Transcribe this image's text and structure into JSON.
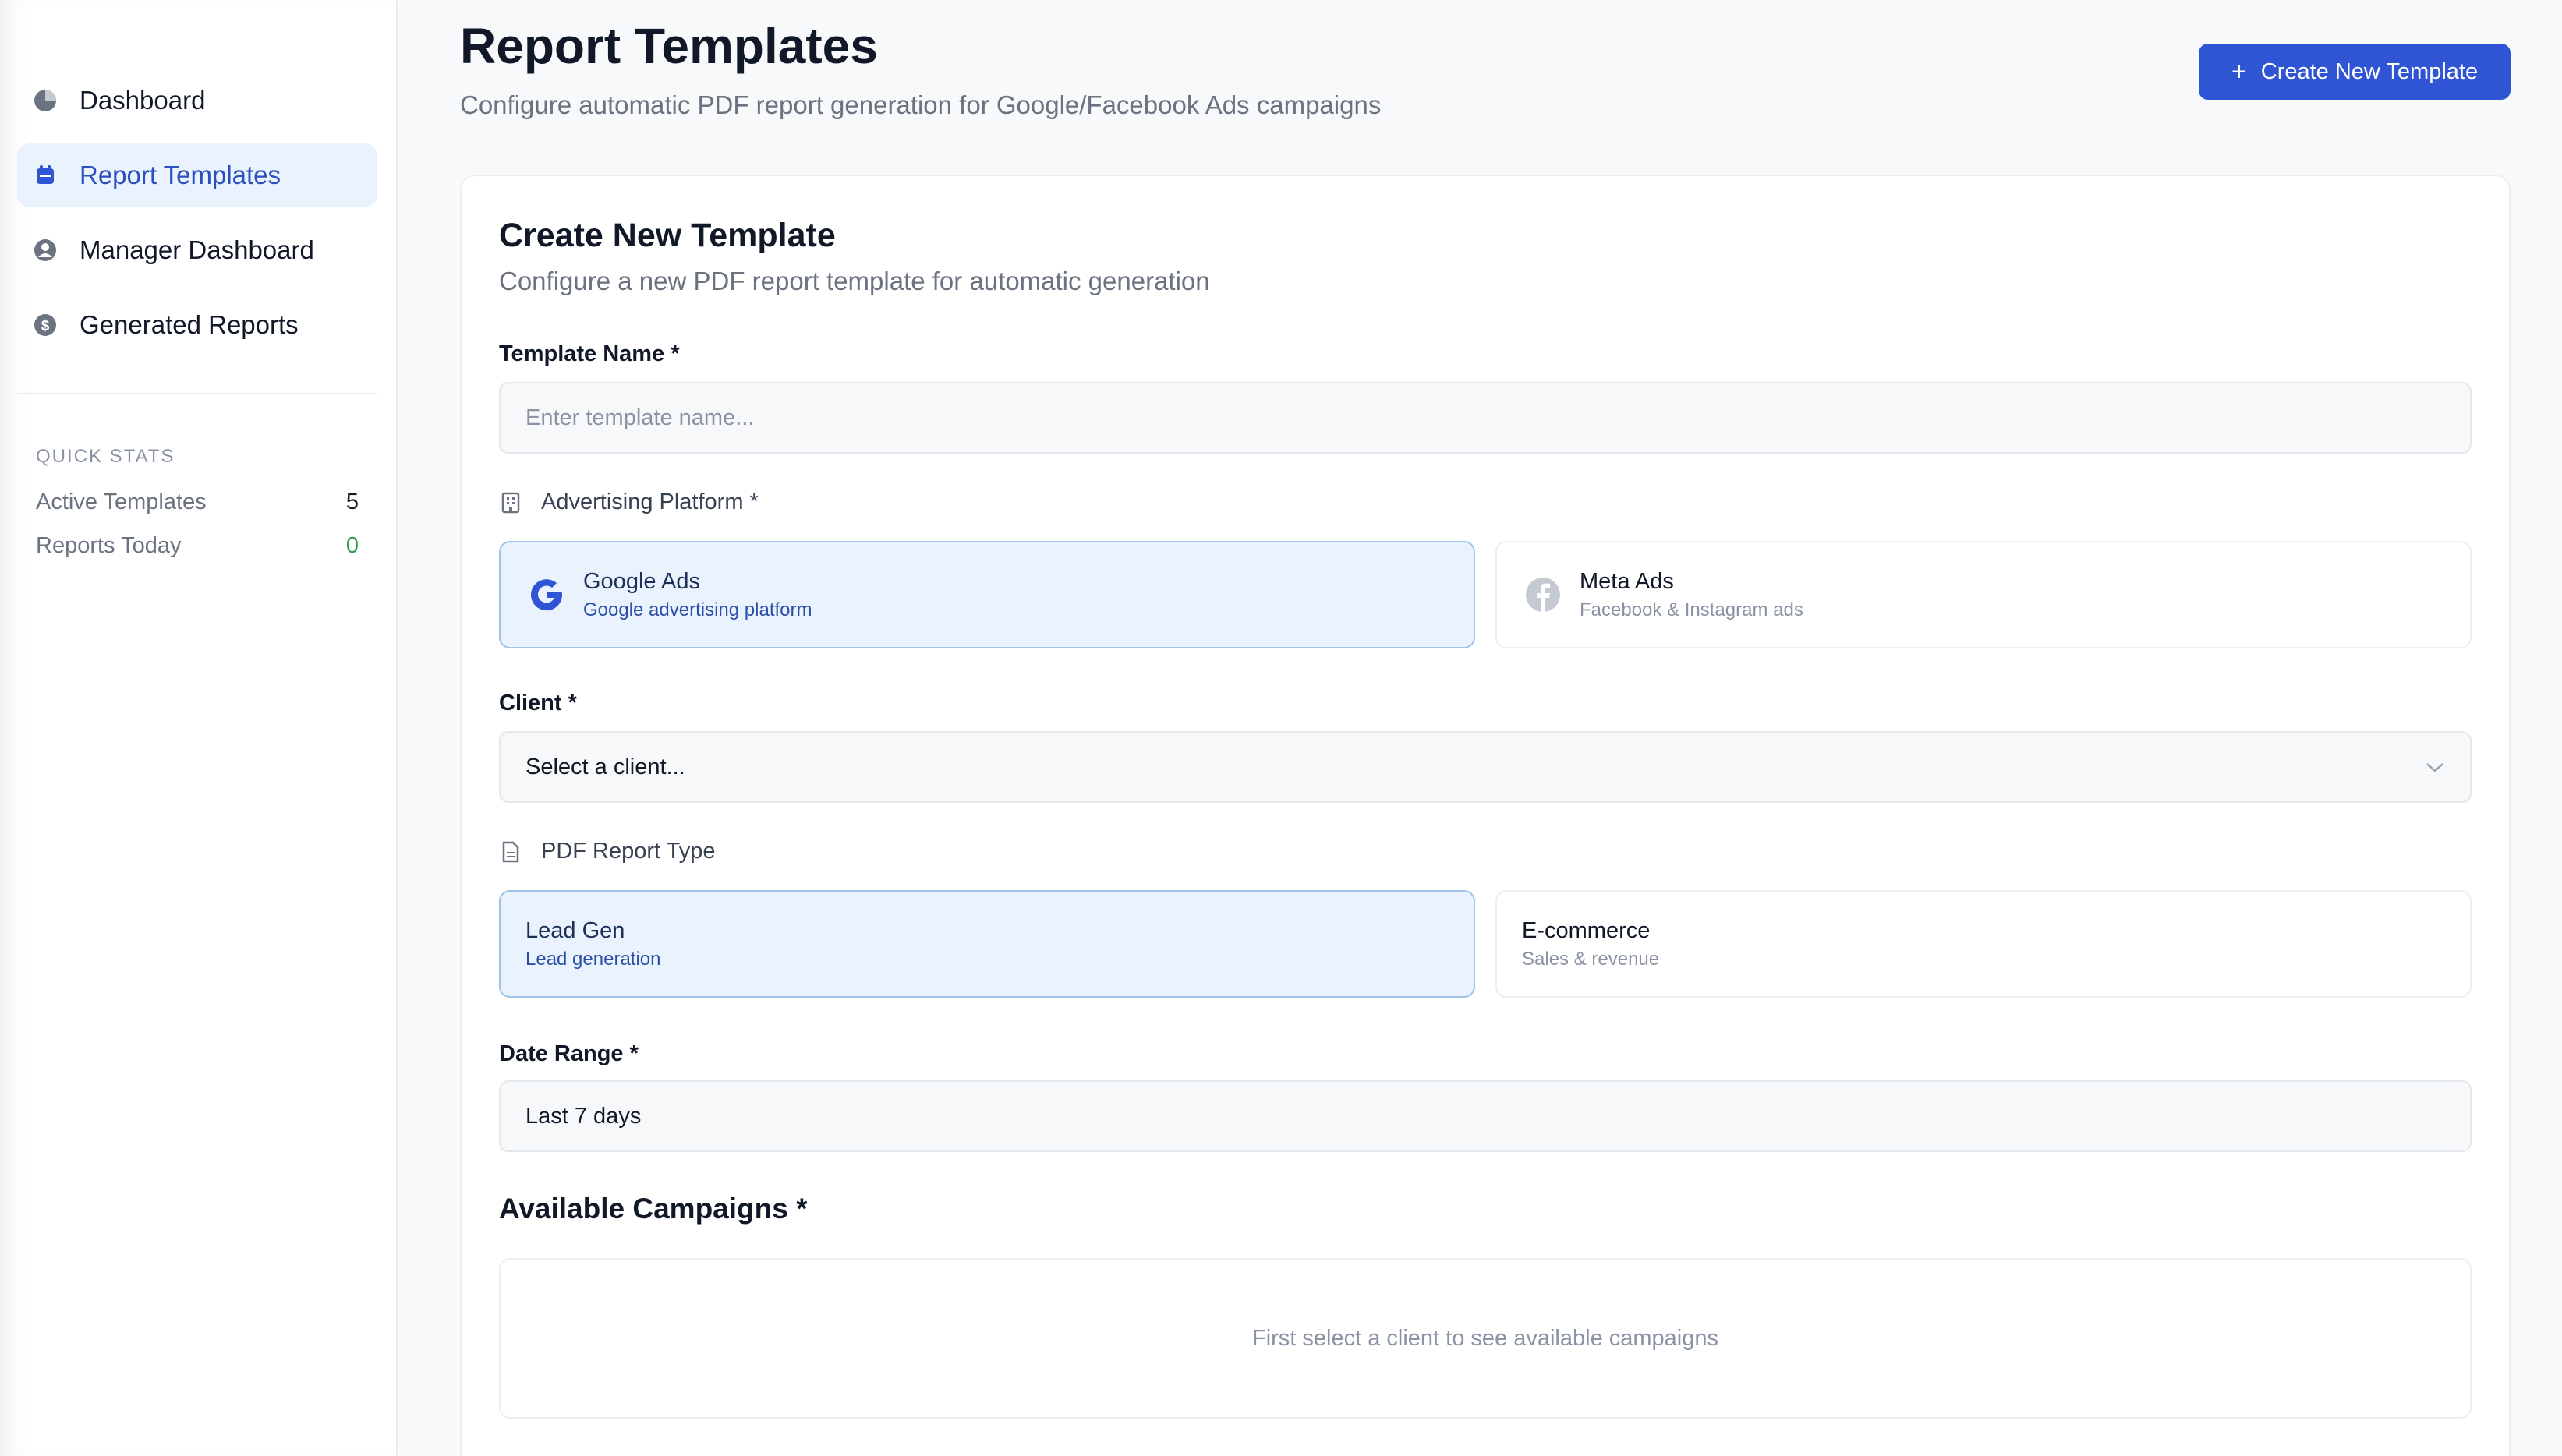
{
  "sidebar": {
    "items": [
      {
        "label": "Dashboard",
        "icon": "pie-chart-icon"
      },
      {
        "label": "Report Templates",
        "icon": "template-icon",
        "active": true
      },
      {
        "label": "Manager Dashboard",
        "icon": "user-circle-icon"
      },
      {
        "label": "Generated Reports",
        "icon": "dollar-circle-icon"
      }
    ],
    "quick_stats": {
      "title": "QUICK STATS",
      "active_templates_label": "Active Templates",
      "active_templates_value": "5",
      "reports_today_label": "Reports Today",
      "reports_today_value": "0"
    }
  },
  "header": {
    "title": "Report Templates",
    "subtitle": "Configure automatic PDF report generation for Google/Facebook Ads campaigns",
    "create_button": "Create New Template"
  },
  "form": {
    "title": "Create New Template",
    "subtitle": "Configure a new PDF report template for automatic generation",
    "template_name_label": "Template Name *",
    "template_name_placeholder": "Enter template name...",
    "template_name_value": "",
    "platform_label": "Advertising Platform *",
    "platforms": [
      {
        "title": "Google Ads",
        "subtitle": "Google advertising platform",
        "icon": "google-g-icon",
        "selected": true
      },
      {
        "title": "Meta Ads",
        "subtitle": "Facebook & Instagram ads",
        "icon": "facebook-icon",
        "selected": false
      }
    ],
    "client_label": "Client *",
    "client_value": "Select a client...",
    "report_type_label": "PDF Report Type",
    "report_types": [
      {
        "title": "Lead Gen",
        "subtitle": "Lead generation",
        "selected": true
      },
      {
        "title": "E-commerce",
        "subtitle": "Sales & revenue",
        "selected": false
      }
    ],
    "date_range_label": "Date Range *",
    "date_range_value": "Last 7 days",
    "campaigns_title": "Available Campaigns *",
    "campaigns_empty": "First select a client to see available campaigns"
  },
  "colors": {
    "accent": "#2f55d4",
    "active_nav_bg": "#eaf2fd",
    "selected_option_bg": "#eaf3fd",
    "selected_option_border": "#9ec3ea",
    "success": "#2ea043"
  }
}
